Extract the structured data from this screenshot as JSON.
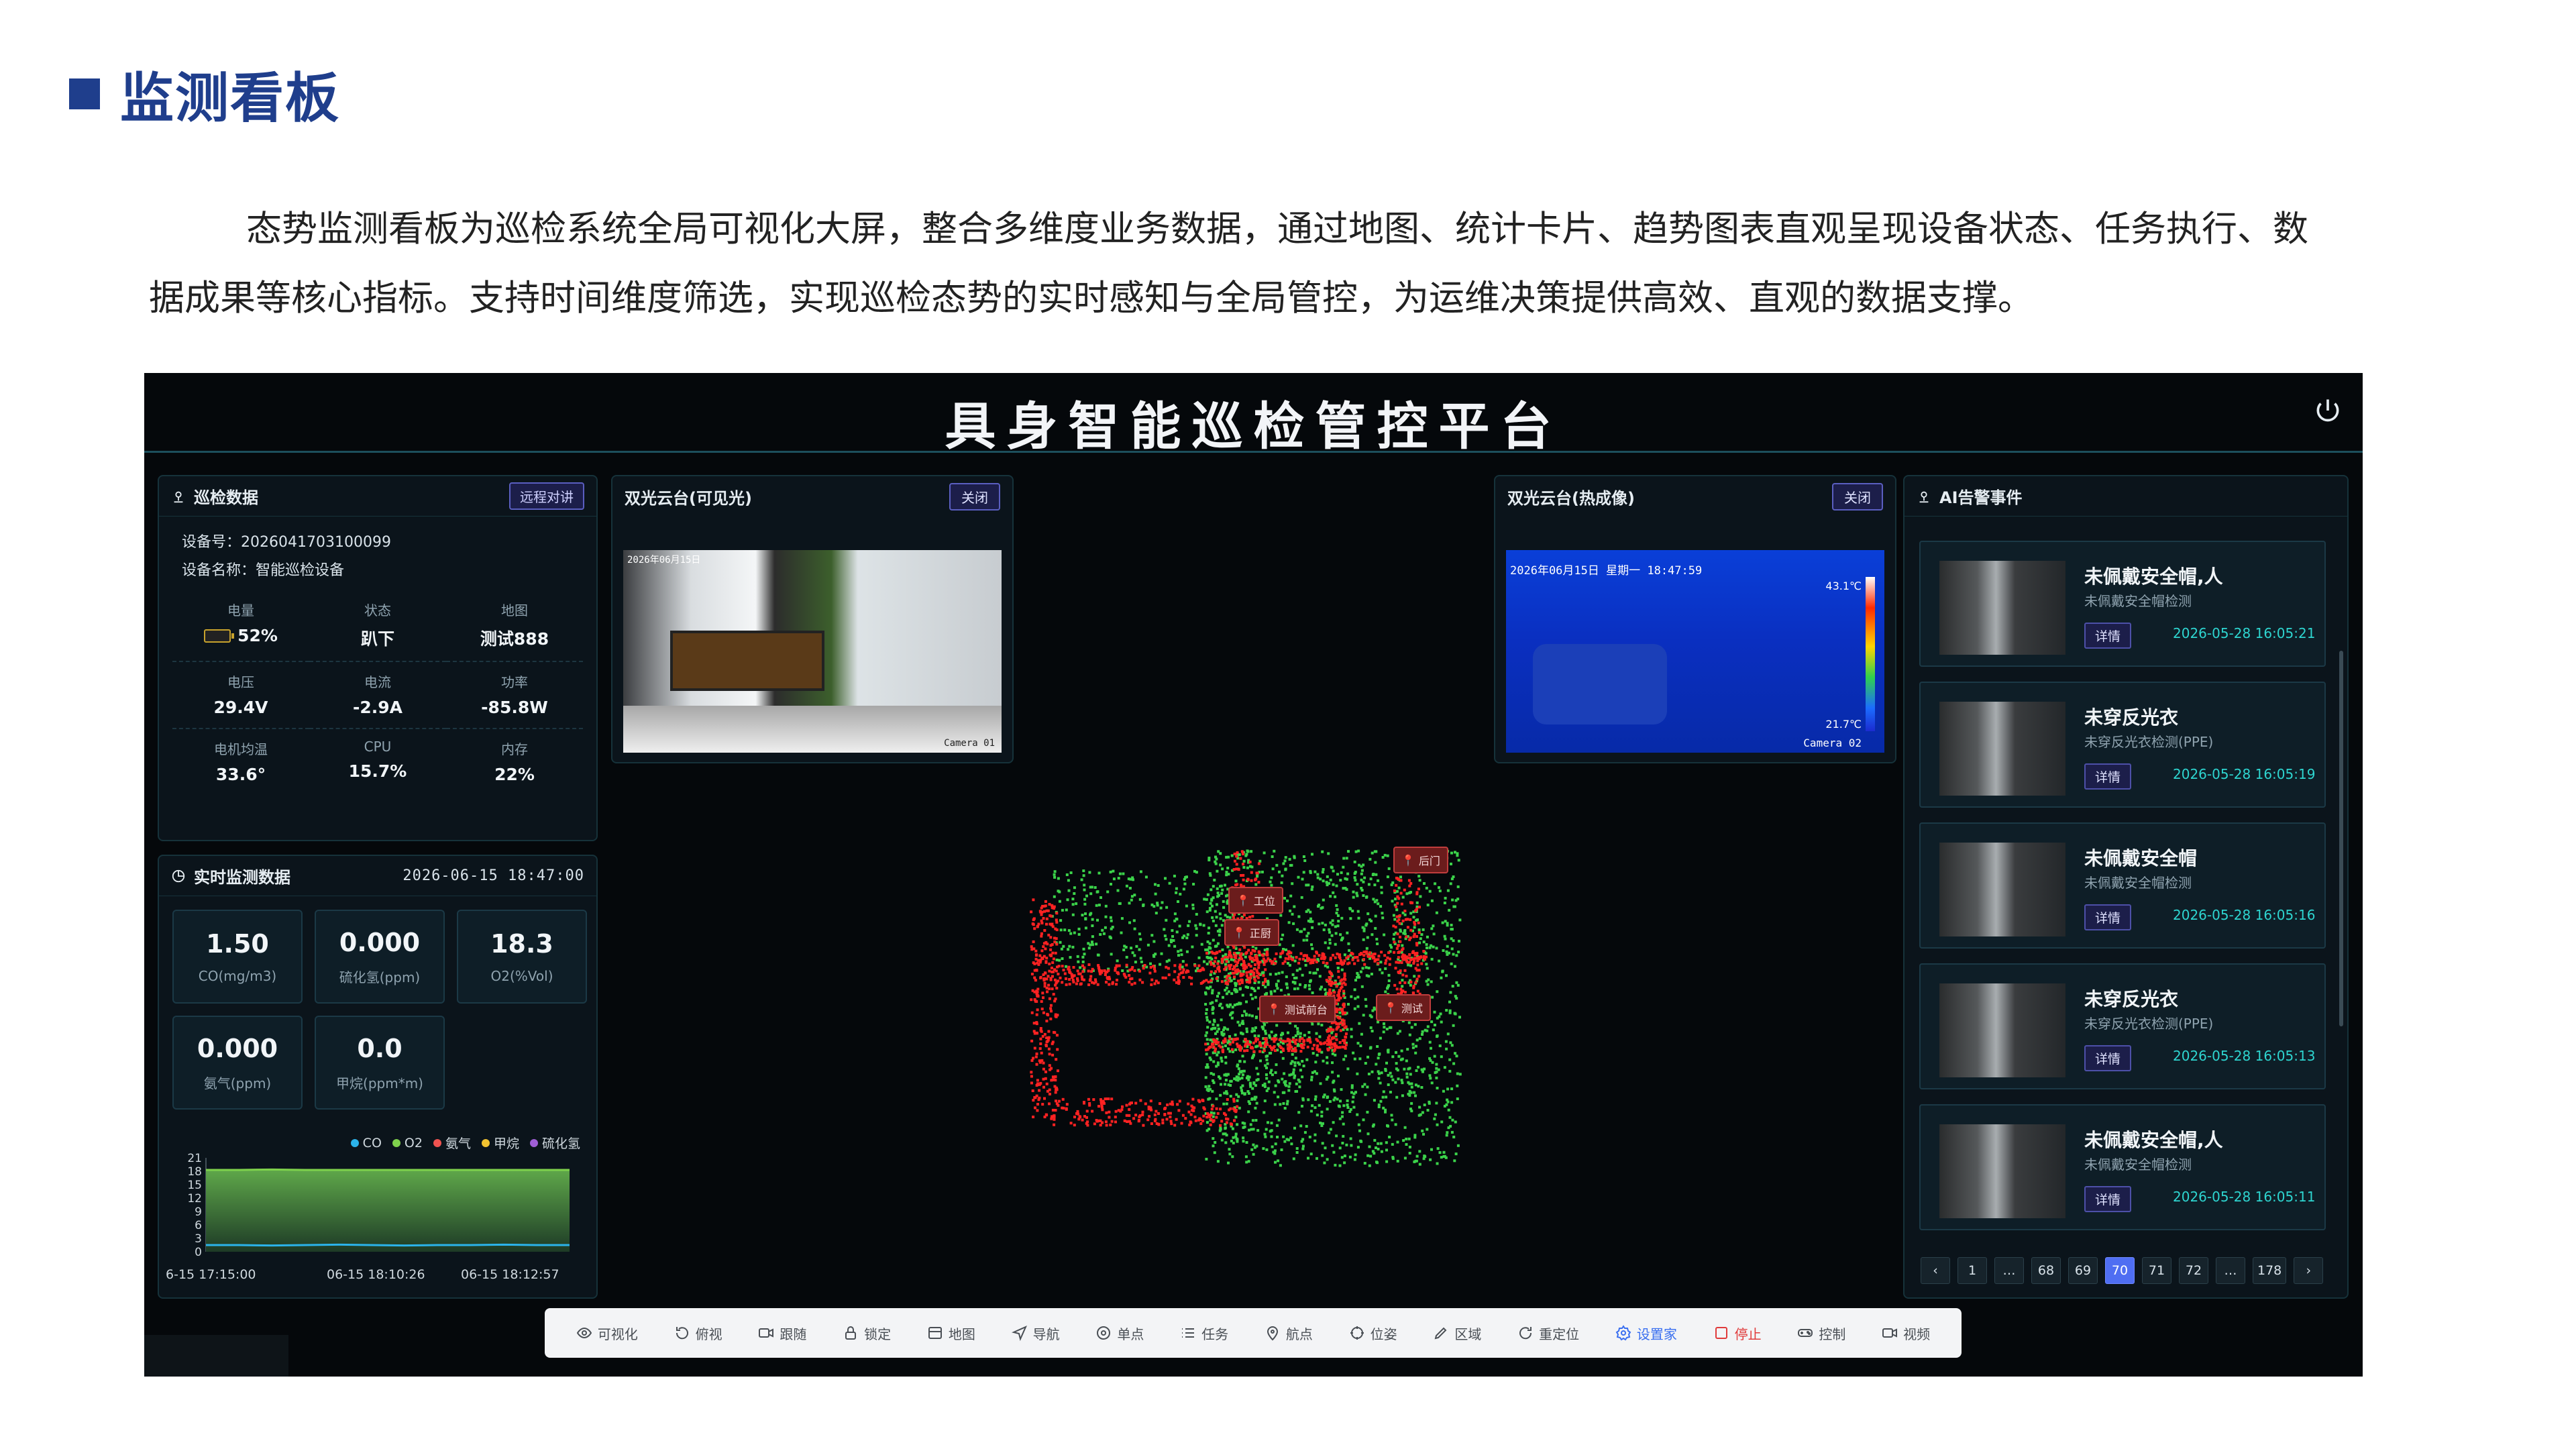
{
  "doc": {
    "title": "监测看板",
    "para_line1": "态势监测看板为巡检系统全局可视化大屏，整合多维度业务数据，通过地图、统计卡片、趋势图表直观呈现设备状态、任务执行、数",
    "para_line2": "据成果等核心指标。支持时间维度筛选，实现巡检态势的实时感知与全局管控，为运维决策提供高效、直观的数据支撑。"
  },
  "app": {
    "title": "具身智能巡检管控平台"
  },
  "patrol": {
    "title": "巡检数据",
    "talk_btn": "远程对讲",
    "device_no": "设备号：2026041703100099",
    "device_name": "设备名称：智能巡检设备",
    "stats": [
      {
        "label": "电量",
        "value": "52%",
        "fraction": 0.52
      },
      {
        "label": "状态",
        "value": "趴下"
      },
      {
        "label": "地图",
        "value": "测试888"
      },
      {
        "label": "电压",
        "value": "29.4V"
      },
      {
        "label": "电流",
        "value": "-2.9A"
      },
      {
        "label": "功率",
        "value": "-85.8W"
      },
      {
        "label": "电机均温",
        "value": "33.6°"
      },
      {
        "label": "CPU",
        "value": "15.7%"
      },
      {
        "label": "内存",
        "value": "22%"
      }
    ]
  },
  "monitor": {
    "title": "实时监测数据",
    "time": "2026-06-15 18:47:00",
    "metrics": [
      {
        "value": "1.50",
        "label": "CO(mg/m3)"
      },
      {
        "value": "0.000",
        "label": "硫化氢(ppm)"
      },
      {
        "value": "18.3",
        "label": "O2(%Vol)"
      },
      {
        "value": "0.000",
        "label": "氨气(ppm)"
      },
      {
        "value": "0.0",
        "label": "甲烷(ppm*m)"
      }
    ],
    "legend": [
      {
        "name": "CO",
        "color": "#2bb3ea"
      },
      {
        "name": "O2",
        "color": "#7fd24c"
      },
      {
        "name": "氨气",
        "color": "#ef5350"
      },
      {
        "name": "甲烷",
        "color": "#f2c230"
      },
      {
        "name": "硫化氢",
        "color": "#a05fd6"
      }
    ]
  },
  "chart_data": {
    "type": "area",
    "x": [
      "6-15 17:15:00",
      "06-15 18:10:26",
      "06-15 18:12:57"
    ],
    "y_ticks": [
      "21",
      "18",
      "15",
      "12",
      "9",
      "6",
      "3",
      "0"
    ],
    "ylim": [
      0,
      21
    ],
    "series": [
      {
        "name": "O2",
        "values": [
          18.3,
          18.3,
          18.4,
          18.3,
          18.3,
          18.3,
          18.3,
          18.3,
          18.3,
          18.3,
          18.3,
          18.3
        ]
      },
      {
        "name": "CO",
        "values": [
          1.5,
          1.5,
          1.4,
          1.5,
          1.6,
          1.5,
          1.4,
          1.5,
          1.5,
          1.6,
          1.5,
          1.5
        ]
      }
    ]
  },
  "cam_visible": {
    "title": "双光云台(可见光)",
    "close": "关闭",
    "timestamp": "2026年06月15日",
    "camera": "Camera 01"
  },
  "cam_thermal": {
    "title": "双光云台(热成像)",
    "close": "关闭",
    "timestamp": "2026年06月15日 星期一 18:47:59",
    "temp_max": "43.1℃",
    "temp_min": "21.7℃",
    "camera": "Camera 02"
  },
  "map": {
    "labels": [
      "后门",
      "工位",
      "正厨",
      "测试前台",
      "测试"
    ]
  },
  "alarms": {
    "title": "AI告警事件",
    "detail_label": "详情",
    "items": [
      {
        "title": "未佩戴安全帽,人",
        "sub": "未佩戴安全帽检测",
        "time": "2026-05-28 16:05:21"
      },
      {
        "title": "未穿反光衣",
        "sub": "未穿反光衣检测(PPE)",
        "time": "2026-05-28 16:05:19"
      },
      {
        "title": "未佩戴安全帽",
        "sub": "未佩戴安全帽检测",
        "time": "2026-05-28 16:05:16"
      },
      {
        "title": "未穿反光衣",
        "sub": "未穿反光衣检测(PPE)",
        "time": "2026-05-28 16:05:13"
      },
      {
        "title": "未佩戴安全帽,人",
        "sub": "未佩戴安全帽检测",
        "time": "2026-05-28 16:05:11"
      }
    ],
    "pager": [
      "‹",
      "1",
      "…",
      "68",
      "69",
      "70",
      "71",
      "72",
      "…",
      "178",
      "›"
    ],
    "active_page": "70"
  },
  "toolbar": {
    "items": [
      {
        "label": "可视化",
        "icon": "eye-icon"
      },
      {
        "label": "俯视",
        "icon": "rotate-icon"
      },
      {
        "label": "跟随",
        "icon": "video-icon"
      },
      {
        "label": "锁定",
        "icon": "lock-icon"
      },
      {
        "label": "地图",
        "icon": "map-icon"
      },
      {
        "label": "导航",
        "icon": "navigation-icon"
      },
      {
        "label": "单点",
        "icon": "target-icon"
      },
      {
        "label": "任务",
        "icon": "list-icon"
      },
      {
        "label": "航点",
        "icon": "pin-icon"
      },
      {
        "label": "位姿",
        "icon": "crosshair-icon"
      },
      {
        "label": "区域",
        "icon": "pen-icon"
      },
      {
        "label": "重定位",
        "icon": "reset-icon"
      },
      {
        "label": "设置家",
        "icon": "home-gear-icon"
      },
      {
        "label": "停止",
        "icon": "stop-icon"
      },
      {
        "label": "控制",
        "icon": "gamepad-icon"
      },
      {
        "label": "视频",
        "icon": "camera-icon"
      }
    ]
  }
}
